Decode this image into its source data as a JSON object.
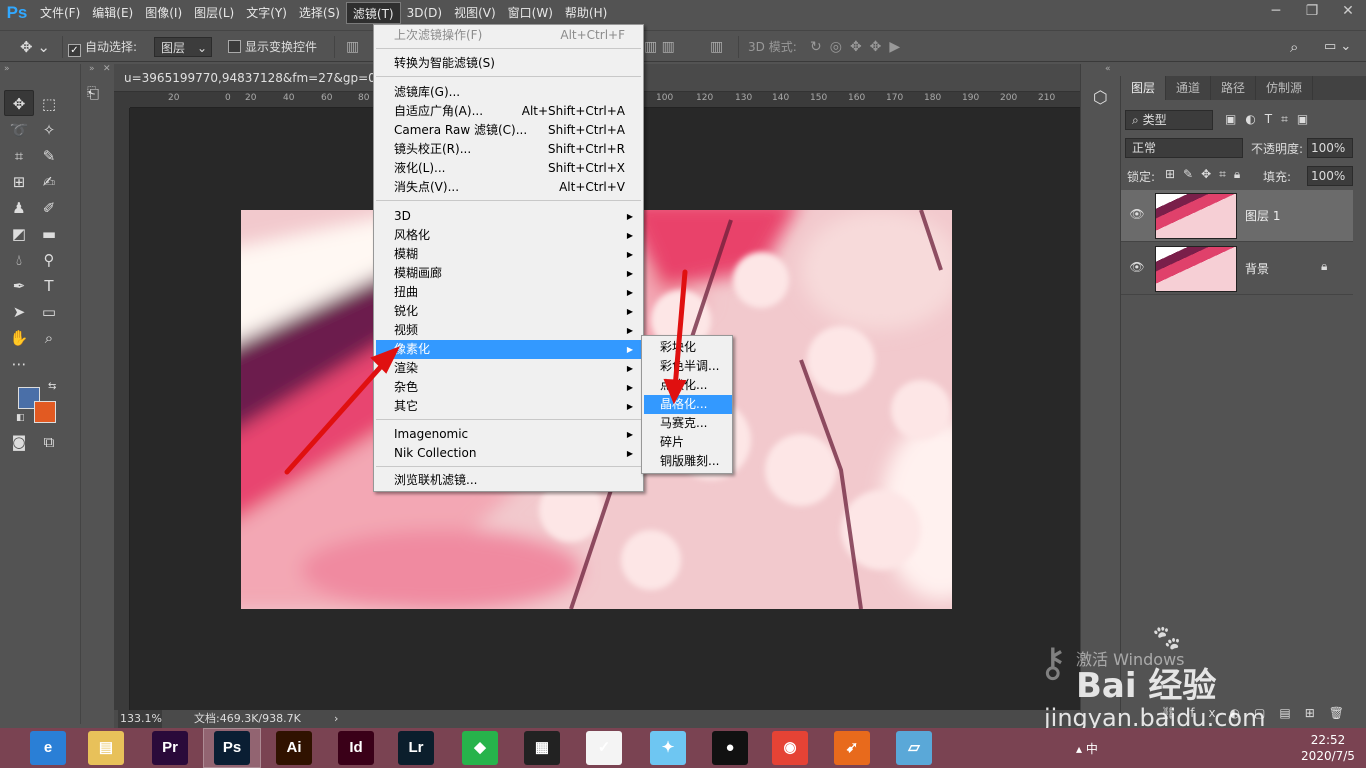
{
  "app": {
    "logo": "Ps"
  },
  "menubar": {
    "items": [
      "文件(F)",
      "编辑(E)",
      "图像(I)",
      "图层(L)",
      "文字(Y)",
      "选择(S)",
      "滤镜(T)",
      "3D(D)",
      "视图(V)",
      "窗口(W)",
      "帮助(H)"
    ],
    "active_index": 6
  },
  "window_controls": [
    "─",
    "❐",
    "✕"
  ],
  "options": {
    "auto_select_label": "自动选择:",
    "auto_select_value": "图层",
    "show_transform_label": "显示变换控件",
    "mode_3d_label": "3D 模式:"
  },
  "document": {
    "tab_title": "u=3965199770,94837128&fm=27&gp=0.jpg",
    "zoom": "133.1%",
    "doc_info": "文档:469.3K/938.7K"
  },
  "ruler": {
    "h_ticks": [
      "20",
      "0",
      "20",
      "40",
      "60",
      "80",
      "100",
      "120",
      "130",
      "140",
      "150",
      "160",
      "170",
      "180",
      "190",
      "200",
      "210"
    ]
  },
  "filter_menu": {
    "last_filter": {
      "label": "上次滤镜操作(F)",
      "shortcut": "Alt+Ctrl+F"
    },
    "smart": "转换为智能滤镜(S)",
    "group1": [
      {
        "label": "滤镜库(G)...",
        "shortcut": ""
      },
      {
        "label": "自适应广角(A)...",
        "shortcut": "Alt+Shift+Ctrl+A"
      },
      {
        "label": "Camera Raw 滤镜(C)...",
        "shortcut": "Shift+Ctrl+A"
      },
      {
        "label": "镜头校正(R)...",
        "shortcut": "Shift+Ctrl+R"
      },
      {
        "label": "液化(L)...",
        "shortcut": "Shift+Ctrl+X"
      },
      {
        "label": "消失点(V)...",
        "shortcut": "Alt+Ctrl+V"
      }
    ],
    "group2": [
      "3D",
      "风格化",
      "模糊",
      "模糊画廊",
      "扭曲",
      "锐化",
      "视频",
      "像素化",
      "渲染",
      "杂色",
      "其它"
    ],
    "highlighted": "像素化",
    "group3": [
      "Imagenomic",
      "Nik Collection"
    ],
    "browse": "浏览联机滤镜..."
  },
  "pixelate_submenu": {
    "items": [
      "彩块化",
      "彩色半调...",
      "点状化...",
      "晶格化...",
      "马赛克...",
      "碎片",
      "铜版雕刻..."
    ],
    "highlighted_index": 3
  },
  "layers_panel": {
    "tabs": [
      "图层",
      "通道",
      "路径",
      "仿制源"
    ],
    "filter_kind": "类型",
    "blend_mode": "正常",
    "opacity_label": "不透明度:",
    "opacity_value": "100%",
    "lock_label": "锁定:",
    "fill_label": "填充:",
    "fill_value": "100%",
    "layers": [
      {
        "name": "图层 1",
        "selected": true
      },
      {
        "name": "背景",
        "selected": false
      }
    ]
  },
  "taskbar": {
    "apps": [
      {
        "name": "browser",
        "glyph": "e",
        "color": "#2a7fd6"
      },
      {
        "name": "file-explorer",
        "glyph": "▤",
        "color": "#e8c15a"
      },
      {
        "name": "premiere",
        "glyph": "Pr",
        "color": "#2a0a3a"
      },
      {
        "name": "photoshop",
        "glyph": "Ps",
        "color": "#0a1e33"
      },
      {
        "name": "illustrator",
        "glyph": "Ai",
        "color": "#301200"
      },
      {
        "name": "indesign",
        "glyph": "Id",
        "color": "#3a0018"
      },
      {
        "name": "lightroom",
        "glyph": "Lr",
        "color": "#0b1e2c"
      },
      {
        "name": "app-green",
        "glyph": "◆",
        "color": "#27b34b"
      },
      {
        "name": "video-editor",
        "glyph": "▦",
        "color": "#222"
      },
      {
        "name": "app-red",
        "glyph": "✓",
        "color": "#f4f4f4"
      },
      {
        "name": "app-bird",
        "glyph": "✦",
        "color": "#6ec6f2"
      },
      {
        "name": "qq",
        "glyph": "●",
        "color": "#111"
      },
      {
        "name": "chrome",
        "glyph": "◉",
        "color": "#e54335"
      },
      {
        "name": "app-orange",
        "glyph": "➹",
        "color": "#e86a1c"
      },
      {
        "name": "app-blue",
        "glyph": "▱",
        "color": "#5aa8d8"
      }
    ],
    "tray_text": "▴ 中",
    "time": "22:52",
    "date": "2020/7/5"
  },
  "watermark": {
    "activate": "激活 Windows",
    "brand": "Bai 经验",
    "url": "jingyan.baidu.com"
  }
}
